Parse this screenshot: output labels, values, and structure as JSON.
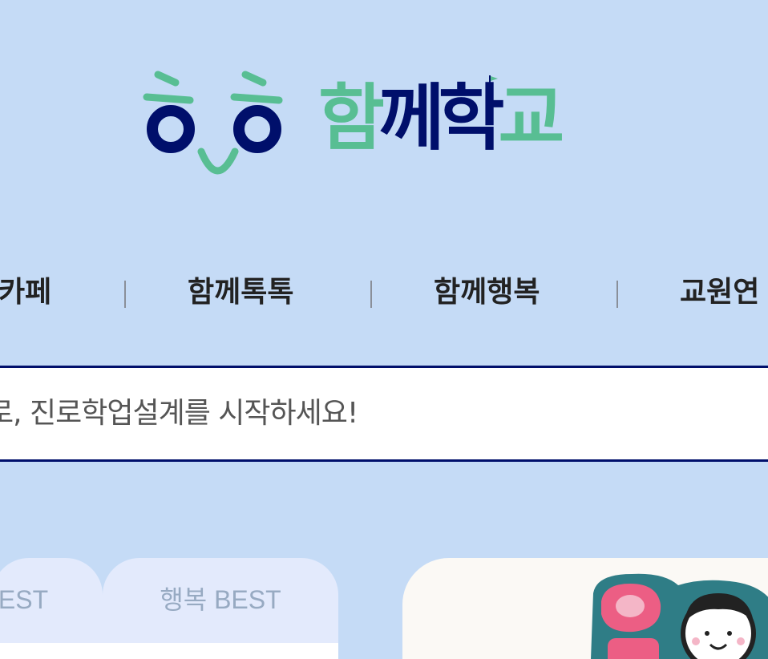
{
  "logo": {
    "text": "함께학교",
    "chars": [
      "함",
      "께",
      "학",
      "교"
    ],
    "colors": {
      "green": "#58be93",
      "navy": "#000f6b"
    },
    "mark_icon": "smiling-face-logo-icon"
  },
  "nav": {
    "items": [
      {
        "label": "카페"
      },
      {
        "label": "함께톡톡"
      },
      {
        "label": "함께행복"
      },
      {
        "label": "교원연"
      }
    ]
  },
  "search_banner": {
    "text": "로, 진로학업설계를 시작하세요!"
  },
  "tabs": {
    "items": [
      {
        "label": "EST"
      },
      {
        "label": "행복 BEST"
      }
    ]
  },
  "promo": {
    "art_icon": "character-illustration-icon"
  },
  "colors": {
    "background": "#c5dbf6",
    "accent_navy": "#000f6b",
    "accent_green": "#58be93",
    "tab_bg": "#e3eafc",
    "tab_text": "#97aac2"
  }
}
